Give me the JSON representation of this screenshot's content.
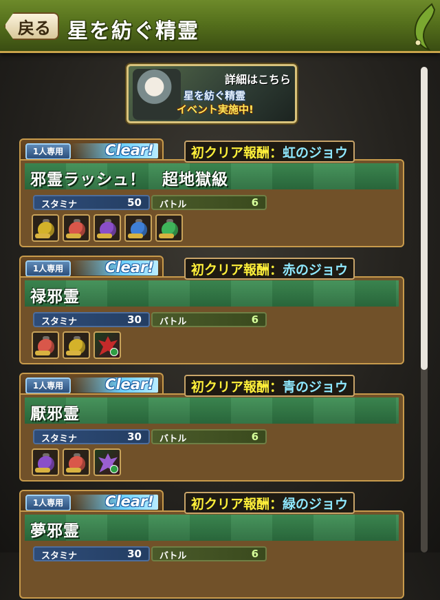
{
  "header": {
    "back_label": "戻る",
    "title": "星を紡ぐ精霊"
  },
  "banner": {
    "detail_label": "詳細はこちら",
    "event_name": "星を紡ぐ精霊",
    "event_status": "イベント実施中!"
  },
  "stat_labels": {
    "stamina": "スタミナ",
    "battle": "バトル"
  },
  "reward_prefix": "初クリア報酬：",
  "dungeons": [
    {
      "badge": "1人専用",
      "status": "Clear!",
      "reward": "虹のジョウ",
      "name": "邪霊ラッシュ！　超地獄級",
      "stamina": "50",
      "battle": "6",
      "drops": [
        {
          "icon": "yellow-bag-icon",
          "color": "#d4b22a"
        },
        {
          "icon": "red-bag-icon",
          "color": "#d9574a"
        },
        {
          "icon": "purple-bag-icon",
          "color": "#8a4fc9"
        },
        {
          "icon": "blue-bag-icon",
          "color": "#3f7fd6"
        },
        {
          "icon": "green-bag-icon",
          "color": "#3fb45a"
        }
      ]
    },
    {
      "badge": "1人専用",
      "status": "Clear!",
      "reward": "赤のジョウ",
      "name": "禄邪霊",
      "stamina": "30",
      "battle": "6",
      "drops": [
        {
          "icon": "red-bag-icon",
          "color": "#d9574a"
        },
        {
          "icon": "yellow-bag-icon",
          "color": "#d4b22a"
        },
        {
          "icon": "monster-icon",
          "monster": true,
          "color": "#c42a2a",
          "orb": "#2f9e44"
        }
      ]
    },
    {
      "badge": "1人専用",
      "status": "Clear!",
      "reward": "青のジョウ",
      "name": "厭邪霊",
      "stamina": "30",
      "battle": "6",
      "drops": [
        {
          "icon": "purple-bag-icon",
          "color": "#8a4fc9"
        },
        {
          "icon": "red-bag-icon",
          "color": "#d9574a"
        },
        {
          "icon": "monster-icon",
          "monster": true,
          "color": "#9a5fd0",
          "orb": "#2f9e44"
        }
      ]
    },
    {
      "badge": "1人専用",
      "status": "Clear!",
      "reward": "緑のジョウ",
      "name": "夢邪霊",
      "stamina": "30",
      "battle": "6",
      "drops": []
    }
  ]
}
